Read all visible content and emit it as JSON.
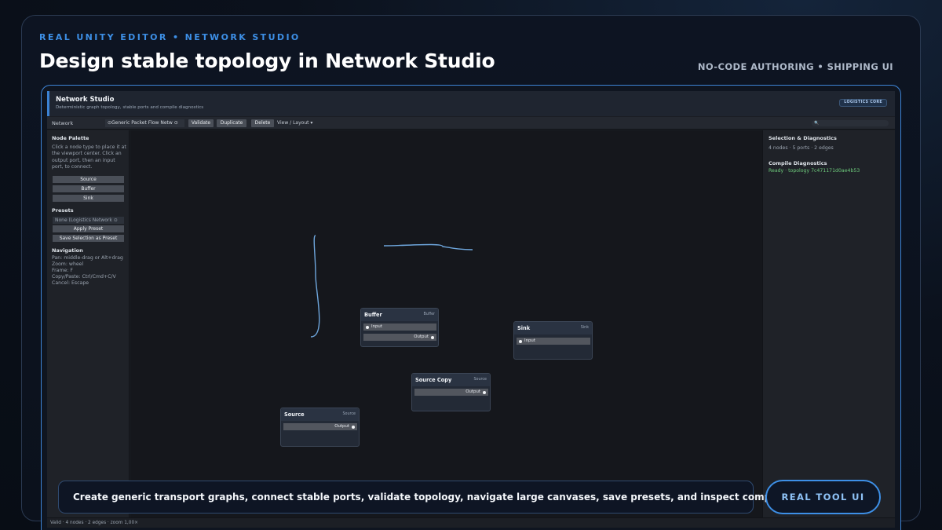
{
  "slide": {
    "kicker": "REAL UNITY EDITOR • NETWORK STUDIO",
    "headline": "Design stable topology in Network Studio",
    "tagline": "NO-CODE AUTHORING • SHIPPING UI",
    "caption": "Create generic transport graphs, connect stable ports, validate topology, navigate large canvases, save presets, and inspect compile diagnostics.",
    "cta_label": "REAL TOOL UI"
  },
  "editor": {
    "title": "Network Studio",
    "subtitle": "Deterministic graph topology, stable ports and compile diagnostics",
    "badge": "LOGISTICS CORE",
    "toolbar": {
      "network_label": "Network",
      "network_value": "⊙Generic Packet Flow Netw ⊙",
      "validate": "Validate",
      "duplicate": "Duplicate",
      "delete": "Delete",
      "view_layout": "View / Layout ▾",
      "search_glyph": "🔍"
    },
    "left_panel": {
      "palette_heading": "Node Palette",
      "palette_help": "Click a node type to place it at the viewport center. Click an output port, then an input port, to connect.",
      "palette_buttons": [
        "Source",
        "Buffer",
        "Sink"
      ],
      "presets_heading": "Presets",
      "preset_field": "None (Logistics Network ⊙",
      "apply_preset": "Apply Preset",
      "save_selection": "Save Selection as Preset",
      "navigation_heading": "Navigation",
      "navigation_lines": [
        "Pan: middle-drag or Alt+drag",
        "Zoom: wheel",
        "Frame: F",
        "Copy/Paste: Ctrl/Cmd+C/V",
        "Cancel: Escape"
      ]
    },
    "right_panel": {
      "heading": "Selection & Diagnostics",
      "summary": "4 nodes · 5 ports · 2 edges",
      "compile_heading": "Compile Diagnostics",
      "compile_status": "Ready · topology 7c471171d0ae4b53"
    },
    "nodes": [
      {
        "title": "Buffer",
        "type": "Buffer",
        "ports": [
          {
            "label": "Input",
            "dir": "in"
          },
          {
            "label": "Output",
            "dir": "out"
          }
        ]
      },
      {
        "title": "Sink",
        "type": "Sink",
        "ports": [
          {
            "label": "Input",
            "dir": "in"
          }
        ]
      },
      {
        "title": "Source Copy",
        "type": "Source",
        "ports": [
          {
            "label": "Output",
            "dir": "out"
          }
        ]
      },
      {
        "title": "Source",
        "type": "Source",
        "ports": [
          {
            "label": "Output",
            "dir": "out"
          }
        ]
      }
    ],
    "status_bar": "Valid · 4 nodes · 2 edges · zoom 1,00×"
  },
  "colors": {
    "accent": "#3d8fe6",
    "wire": "#6ea6dc",
    "ok_text": "#6ecb7c"
  }
}
